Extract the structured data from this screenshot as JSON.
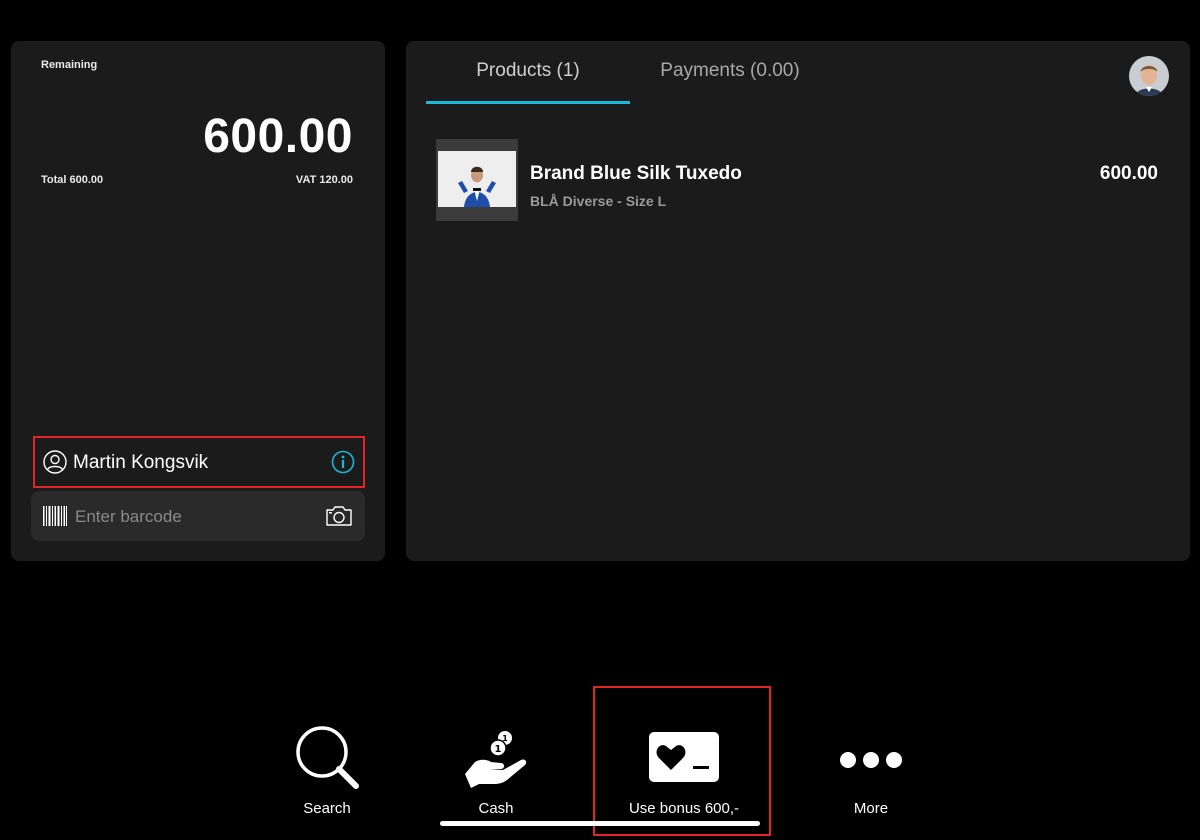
{
  "summary": {
    "remaining_label": "Remaining",
    "remaining_amount": "600.00",
    "total_label": "Total 600.00",
    "vat_label": "VAT 120.00"
  },
  "customer": {
    "name": "Martin Kongsvik",
    "icon": "user-icon",
    "info_icon": "info-icon"
  },
  "barcode": {
    "placeholder": "Enter barcode",
    "value": "",
    "icon": "barcode-icon",
    "camera_icon": "camera-icon"
  },
  "tabs": [
    {
      "label": "Products (1)",
      "active": true
    },
    {
      "label": "Payments (0.00)",
      "active": false
    }
  ],
  "products": [
    {
      "name": "Brand Blue Silk Tuxedo",
      "variant": "BLÅ Diverse - Size L",
      "price": "600.00"
    }
  ],
  "toolbar": {
    "search_label": "Search",
    "cash_label": "Cash",
    "bonus_label": "Use bonus 600,-",
    "more_label": "More"
  },
  "colors": {
    "background": "#000000",
    "panel": "#1b1b1b",
    "accent": "#19b8d8",
    "highlight": "#e0262b"
  }
}
